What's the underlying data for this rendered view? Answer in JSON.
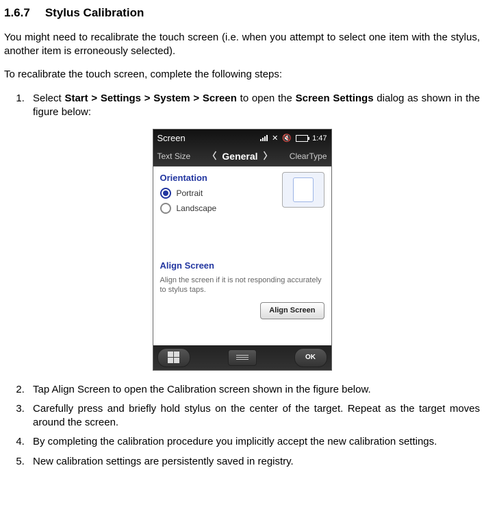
{
  "heading": {
    "number": "1.6.7",
    "title": "Stylus Calibration"
  },
  "intro1": "You might need to recalibrate the touch screen (i.e. when you attempt to select one item with the stylus, another item is erroneously selected).",
  "intro2": "To recalibrate the touch screen, complete the following steps:",
  "step1": {
    "prefix": "Select  ",
    "bold1": "Start > Settings > System > Screen",
    "mid": " to open the ",
    "bold2": "Screen Settings",
    "suffix": " dialog as shown in the figure below:"
  },
  "screenshot": {
    "title": "Screen",
    "time": "1:47",
    "tabs": {
      "left": "Text Size",
      "center": "General",
      "right": "ClearType"
    },
    "orientation_header": "Orientation",
    "radio_portrait": "Portrait",
    "radio_landscape": "Landscape",
    "align_header": "Align Screen",
    "align_text": "Align the screen if it is not responding accurately to stylus taps.",
    "align_button": "Align Screen",
    "ok": "OK"
  },
  "step2": "Tap Align Screen to open the Calibration screen shown in the figure below.",
  "step3": "Carefully press and briefly hold stylus on the center of the target. Repeat as the target moves around the screen.",
  "step4": "By completing the calibration procedure you implicitly accept the new calibration settings.",
  "step5": "New calibration settings are persistently saved in registry."
}
